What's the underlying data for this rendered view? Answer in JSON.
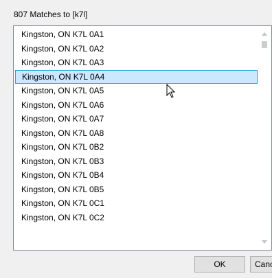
{
  "dialog": {
    "header": "807 Matches to [k7l]",
    "ok_label": "OK",
    "cancel_label": "Cancel"
  },
  "list": {
    "selected_index": 3,
    "items": [
      "Kingston, ON K7L 0A1",
      "Kingston, ON K7L 0A2",
      "Kingston, ON K7L 0A3",
      "Kingston, ON K7L 0A4",
      "Kingston, ON K7L 0A5",
      "Kingston, ON K7L 0A6",
      "Kingston, ON K7L 0A7",
      "Kingston, ON K7L 0A8",
      "Kingston, ON K7L 0B2",
      "Kingston, ON K7L 0B3",
      "Kingston, ON K7L 0B4",
      "Kingston, ON K7L 0B5",
      "Kingston, ON K7L 0C1",
      "Kingston, ON K7L 0C2"
    ]
  },
  "icons": {
    "scroll_up": "scroll-up-arrow-icon",
    "scroll_down": "scroll-down-arrow-icon",
    "cursor": "mouse-pointer-icon"
  },
  "colors": {
    "selection_bg": "#cce8ff",
    "selection_border": "#26a0da"
  }
}
